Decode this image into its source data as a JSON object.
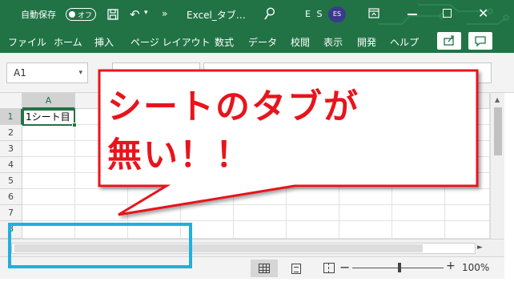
{
  "titlebar": {
    "autosave_label": "自動保存",
    "autosave_state": "オフ",
    "filename": "Excel_タブ…",
    "initials": "E S",
    "avatar": "ES",
    "more": "»",
    "undo": "↶",
    "undo_dropdown": "▾",
    "close": "✕"
  },
  "menu": [
    "ファイル",
    "ホーム",
    "挿入",
    "ページ レイアウト",
    "数式",
    "データ",
    "校閲",
    "表示",
    "開発",
    "ヘルプ"
  ],
  "namebox": {
    "value": "A1",
    "dropdown": "▾"
  },
  "columns": [
    "A"
  ],
  "rows": [
    "1",
    "2",
    "3",
    "4",
    "5",
    "6",
    "7",
    "8"
  ],
  "cell_a1": "1シート目",
  "hscroll": {
    "right_arrow": "►"
  },
  "vscroll": {
    "up_arrow": "▲"
  },
  "status": {
    "zoom_minus": "−",
    "zoom_plus": "+",
    "zoom_level": "100%"
  },
  "annotation": {
    "line1": "シートのタブが",
    "line2": "無い！！"
  },
  "colors": {
    "excel_green": "#217346",
    "callout_red": "#e8141c",
    "highlight_blue": "#1fb0e0"
  },
  "icons": [
    "save-icon",
    "search-icon",
    "ribbon-display-icon",
    "share-icon",
    "comment-icon",
    "normal-view-icon",
    "page-layout-view-icon",
    "page-break-view-icon"
  ]
}
